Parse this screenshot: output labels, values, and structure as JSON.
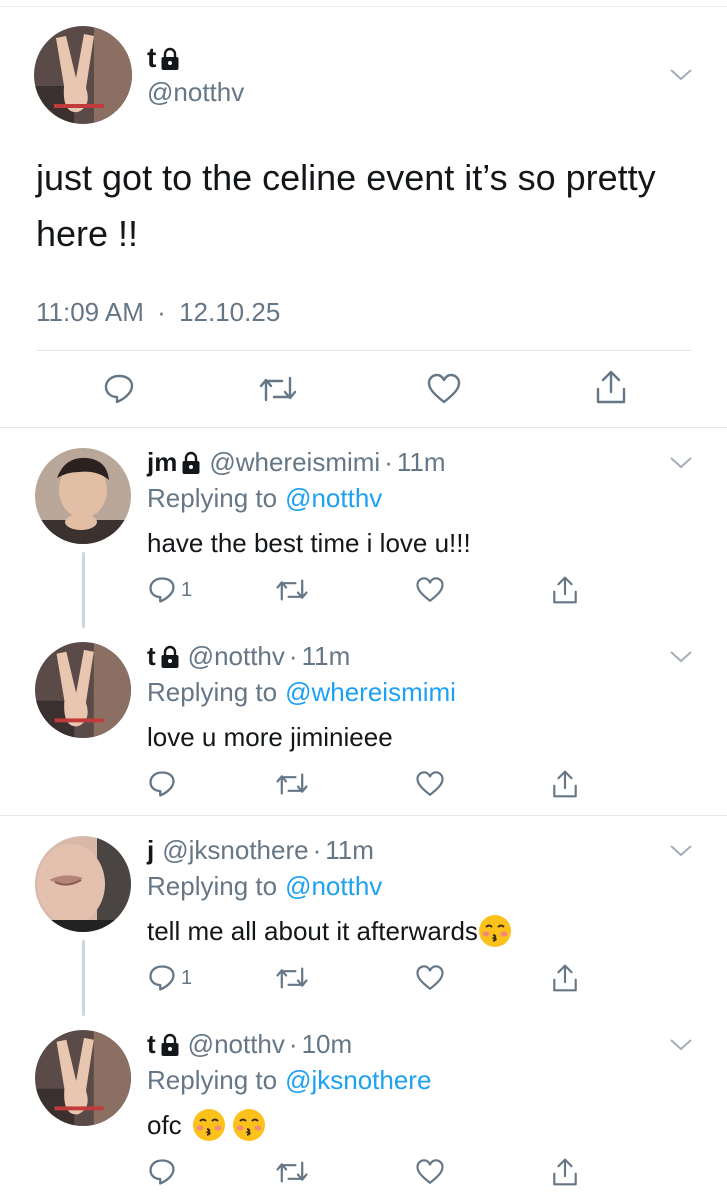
{
  "main_tweet": {
    "name": "t",
    "handle": "@notthv",
    "text": "just got to the celine event it’s so pretty here !!",
    "time": "11:09 AM",
    "date": "12.10.25",
    "separator": "·"
  },
  "replies": [
    {
      "name": "jm",
      "handle": "@whereismimi",
      "time": "11m",
      "replying_label": "Replying to",
      "replying_to": "@notthv",
      "text": "have the best time i love u!!!",
      "reply_count": "1",
      "locked": true
    },
    {
      "name": "t",
      "handle": "@notthv",
      "time": "11m",
      "replying_label": "Replying to",
      "replying_to": "@whereismimi",
      "text": "love u more jiminieee",
      "reply_count": "",
      "locked": true
    },
    {
      "name": "j",
      "handle": "@jksnothere",
      "time": "11m",
      "replying_label": "Replying to",
      "replying_to": "@notthv",
      "text": "tell me all about it afterwards",
      "reply_count": "1",
      "locked": false
    },
    {
      "name": "t",
      "handle": "@notthv",
      "time": "10m",
      "replying_label": "Replying to",
      "replying_to": "@jksnothere",
      "text": "ofc",
      "reply_count": "",
      "locked": true
    }
  ],
  "icons": {
    "reply": "reply-icon",
    "retweet": "retweet-icon",
    "like": "heart-icon",
    "share": "share-icon",
    "more": "chevron-down-icon",
    "lock": "lock-icon",
    "emoji": "kissing-face-emoji"
  },
  "colors": {
    "text": "#14171a",
    "secondary": "#657786",
    "link": "#1da1f2",
    "divider": "#e1e8ed"
  }
}
